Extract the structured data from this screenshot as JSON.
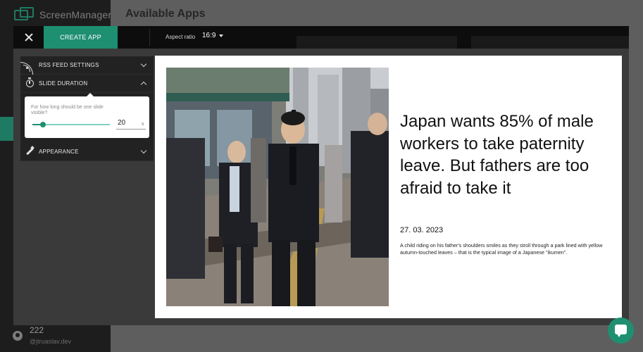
{
  "background": {
    "logo_text": "ScreenManager",
    "page_title": "Available Apps",
    "user": {
      "name": "222",
      "email": "@jtruaslav.dev"
    }
  },
  "toolbar": {
    "create_label": "CREATE APP",
    "aspect_label": "Aspect ratio",
    "aspect_value": "16:9"
  },
  "settings": {
    "rss_label": "RSS FEED SETTINGS",
    "duration_label": "SLIDE DURATION",
    "duration_question": "For how long should be one slide visible?",
    "duration_value": "20",
    "duration_unit": "s",
    "duration_fraction": 0.14,
    "appearance_label": "APPEARANCE"
  },
  "preview": {
    "headline": "Japan wants 85% of male workers to take paternity leave. But fathers are too afraid to take it",
    "date": "27. 03. 2023",
    "description": "A child riding on his father's shoulders smiles as they stroll through a park lined with yellow autumn-touched leaves – that is the typical image of a Japanese \"ikumen\"."
  },
  "colors": {
    "accent": "#1f8f71",
    "modal_bar": "#0d0d0d",
    "panel": "#222222"
  },
  "icons": {
    "close": "close-icon",
    "rss": "rss-icon",
    "timer": "timer-icon",
    "appearance": "pen-icon",
    "chat": "chat-icon"
  }
}
